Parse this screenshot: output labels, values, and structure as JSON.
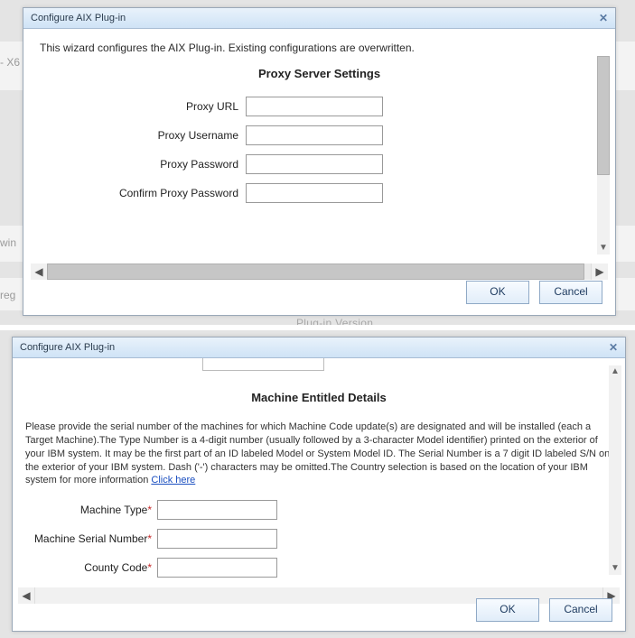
{
  "background": {
    "frag1": "- X6",
    "frag2": "win",
    "frag3": "reg",
    "plugin_version": "Plug-in Version"
  },
  "dialog1": {
    "title": "Configure AIX Plug-in",
    "intro": "This wizard configures the AIX Plug-in. Existing configurations are overwritten.",
    "section_title": "Proxy Server Settings",
    "fields": {
      "url": {
        "label": "Proxy URL",
        "value": ""
      },
      "username": {
        "label": "Proxy Username",
        "value": ""
      },
      "password": {
        "label": "Proxy Password",
        "value": ""
      },
      "confirm": {
        "label": "Confirm Proxy Password",
        "value": ""
      }
    },
    "buttons": {
      "ok": "OK",
      "cancel": "Cancel"
    }
  },
  "dialog2": {
    "title": "Configure AIX Plug-in",
    "clipped_label": "",
    "section_title": "Machine Entitled Details",
    "description": "Please provide the serial number of the machines for which Machine Code update(s) are designated and will be installed (each a Target Machine).The Type Number is a 4-digit number (usually followed by a 3-character Model identifier) printed on the exterior of your IBM system. It may be the first part of an ID labeled Model or System Model ID. The Serial Number is a 7 digit ID labeled S/N on the exterior of your IBM system. Dash ('-') characters may be omitted.The Country selection is based on the location of your IBM system for more information ",
    "link_text": "Click here",
    "fields": {
      "type": {
        "label": "Machine Type",
        "value": ""
      },
      "serial": {
        "label": "Machine Serial Number",
        "value": ""
      },
      "county": {
        "label": "County Code",
        "value": ""
      }
    },
    "buttons": {
      "ok": "OK",
      "cancel": "Cancel"
    }
  }
}
